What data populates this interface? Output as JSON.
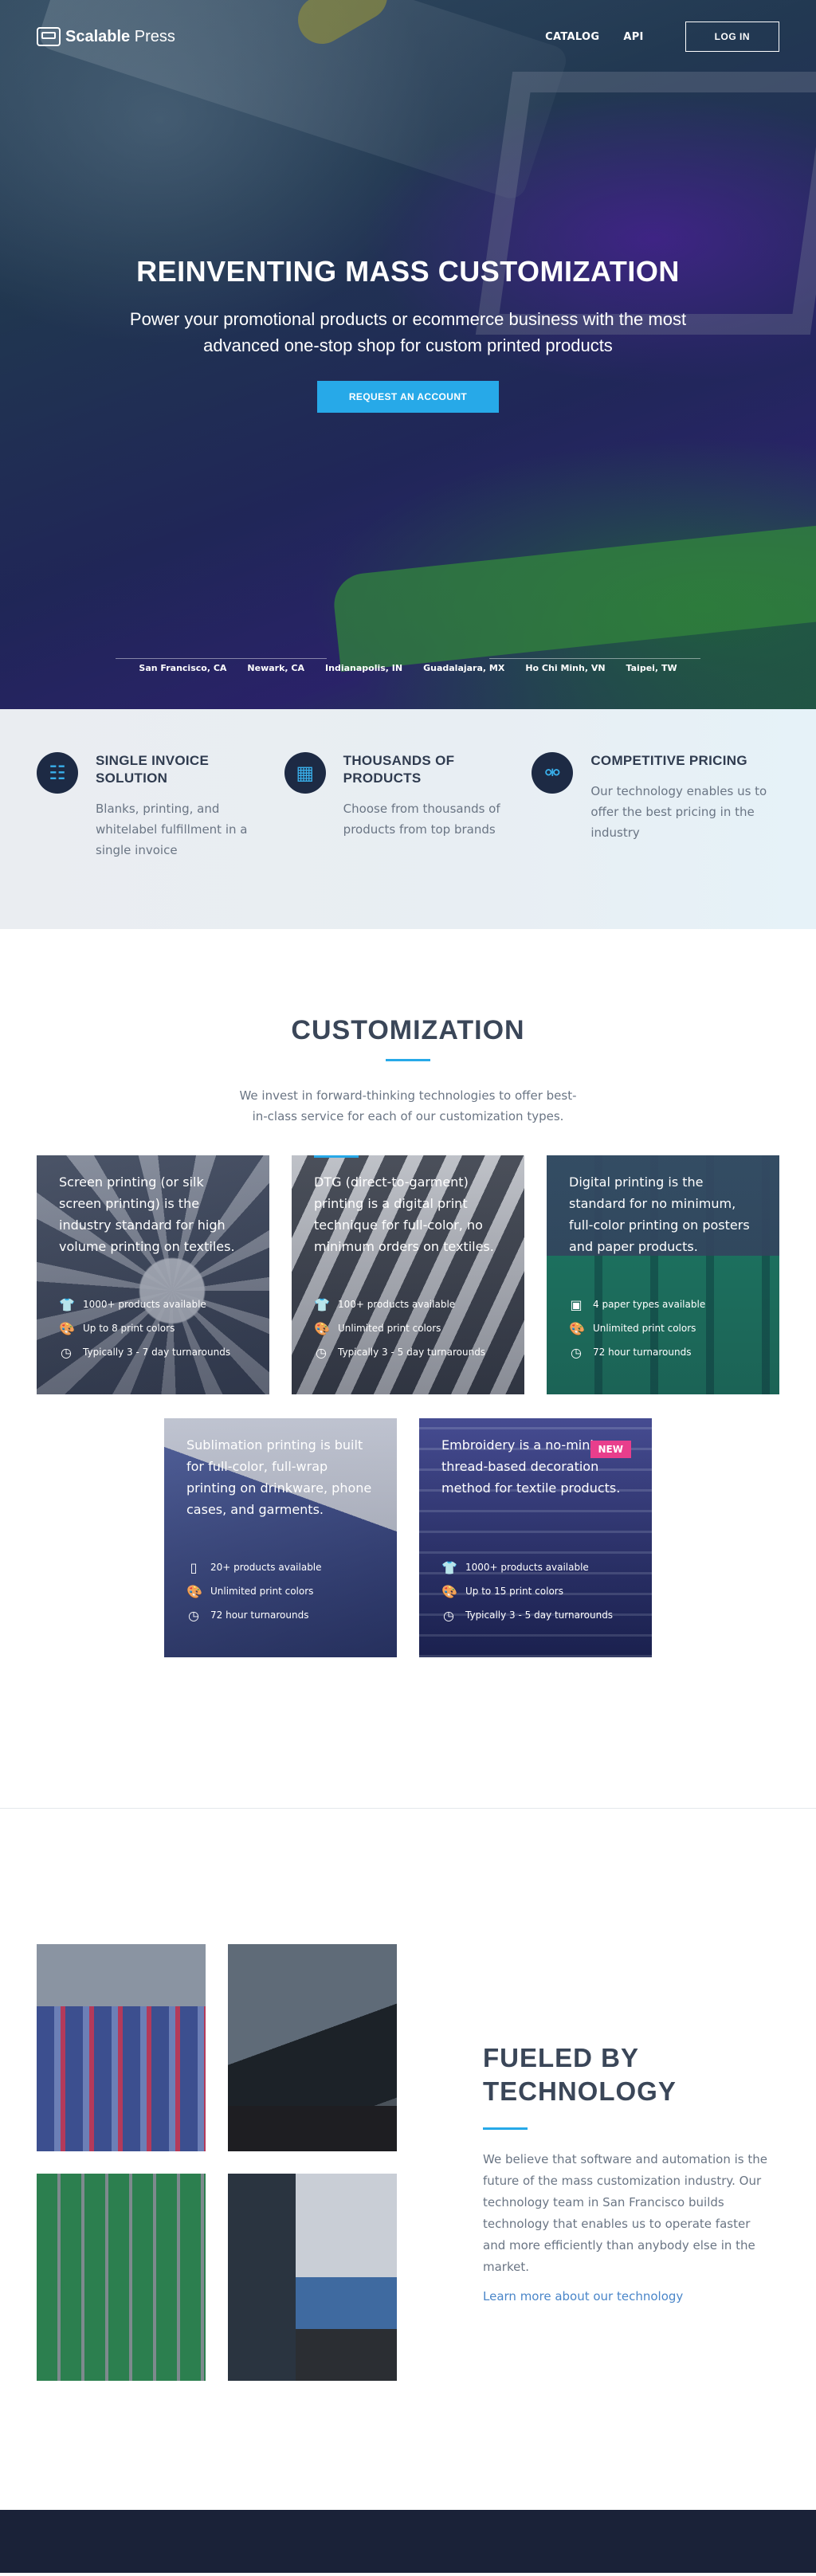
{
  "nav": {
    "logo_text_bold": "Scalable",
    "logo_text": " Press",
    "links": [
      "CATALOG",
      "API"
    ],
    "login": "LOG IN"
  },
  "hero": {
    "title": "REINVENTING MASS CUSTOMIZATION",
    "subtitle": "Power your promotional products or ecommerce business with the most advanced one-stop shop for custom printed products",
    "cta": "REQUEST AN ACCOUNT",
    "locations": [
      "San Francisco, CA",
      "Newark, CA",
      "Indianapolis, IN",
      "Guadalajara, MX",
      "Ho Chi Minh, VN",
      "Taipei, TW"
    ]
  },
  "features": [
    {
      "icon": "invoice-icon",
      "title": "Single invoice solution",
      "desc": "Blanks, printing, and whitelabel fulfillment in a single invoice"
    },
    {
      "icon": "products-icon",
      "title": "Thousands of products",
      "desc": "Choose from thousands of products from top brands"
    },
    {
      "icon": "price-tag-icon",
      "title": "Competitive pricing",
      "desc": "Our technology enables us to offer the best pricing in the industry"
    }
  ],
  "customization": {
    "title": "CUSTOMIZATION",
    "desc": "We invest in forward-thinking technologies to offer best-in-class service for each of our customization types.",
    "cards": [
      {
        "key": "screen",
        "text": "Screen printing (or silk screen printing) is the industry standard for high volume printing on textiles.",
        "items": [
          {
            "icon": "shirt-icon",
            "text": "1000+ products available"
          },
          {
            "icon": "palette-icon",
            "text": "Up to 8 print colors"
          },
          {
            "icon": "clock-icon",
            "text": "Typically 3 - 7 day turnarounds"
          }
        ]
      },
      {
        "key": "dtg",
        "text": "DTG (direct-to-garment) printing is a digital print technique for full-color, no minimum orders on textiles.",
        "items": [
          {
            "icon": "shirt-icon",
            "text": "100+ products available"
          },
          {
            "icon": "palette-icon",
            "text": "Unlimited print colors"
          },
          {
            "icon": "clock-icon",
            "text": "Typically 3 - 5 day turnarounds"
          }
        ]
      },
      {
        "key": "digital",
        "text": "Digital printing is the standard for no minimum, full-color printing on posters and paper products.",
        "items": [
          {
            "icon": "image-icon",
            "text": "4 paper types available"
          },
          {
            "icon": "palette-icon",
            "text": "Unlimited print colors"
          },
          {
            "icon": "clock-icon",
            "text": "72 hour turnarounds"
          }
        ]
      },
      {
        "key": "sub",
        "text": "Sublimation printing is built for full-color, full-wrap printing on drinkware, phone cases, and garments.",
        "items": [
          {
            "icon": "phone-icon",
            "text": "20+ products available"
          },
          {
            "icon": "palette-icon",
            "text": "Unlimited print colors"
          },
          {
            "icon": "clock-icon",
            "text": "72 hour turnarounds"
          }
        ]
      },
      {
        "key": "embroid",
        "text": "Embroidery is a no-minimum thread-based decoration method for textile products.",
        "badge": "NEW",
        "items": [
          {
            "icon": "shirt-icon",
            "text": "1000+ products available"
          },
          {
            "icon": "palette-icon",
            "text": "Up to 15 print colors"
          },
          {
            "icon": "clock-icon",
            "text": "Typically 3 - 5 day turnarounds"
          }
        ]
      }
    ]
  },
  "technology": {
    "title_line1": "FUELED BY",
    "title_line2": "TECHNOLOGY",
    "desc": "We believe that software and automation is the future of the mass customization industry. Our technology team in San Francisco builds technology that enables us to operate faster and more efficiently than anybody else in the market.",
    "link": "Learn more about our technology"
  },
  "colors": {
    "accent": "#27a9e8",
    "navy": "#1d2a44",
    "badge": "#e83e8c",
    "link": "#4a86c9"
  }
}
